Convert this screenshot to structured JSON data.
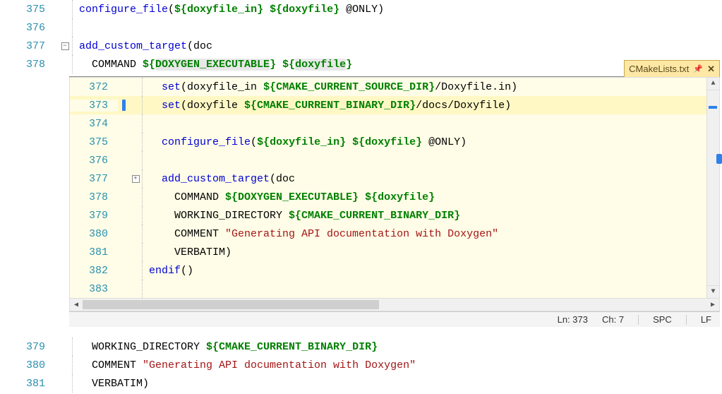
{
  "outer": {
    "lines": [
      {
        "num": "375",
        "html": "<span class='k-blue'>configure_file</span>(<span class='k-green'>${doxyfile_in}</span> <span class='k-green'>${doxyfile}</span> @ONLY)"
      },
      {
        "num": "376",
        "html": ""
      },
      {
        "num": "377",
        "html": "<span class='k-blue'>add_custom_target</span>(doc",
        "fold": true
      },
      {
        "num": "378",
        "html": "  COMMAND <span class='k-green'>${</span><span class='k-green hl'>DOXYGEN_EXECUTABLE</span><span class='k-green'>}</span> <span class='k-green'>${</span><span class='k-green hl'>doxyfile</span><span class='k-green'>}</span>"
      }
    ],
    "lines2": [
      {
        "num": "379",
        "html": "  WORKING_DIRECTORY <span class='k-green'>${CMAKE_CURRENT_BINARY_DIR}</span>"
      },
      {
        "num": "380",
        "html": "  COMMENT <span class='k-str'>\"Generating API documentation with Doxygen\"</span>"
      },
      {
        "num": "381",
        "html": "  VERBATIM)"
      }
    ]
  },
  "inner": {
    "tab": {
      "title": "CMakeLists.txt"
    },
    "lines": [
      {
        "num": "372",
        "html": "  <span class='k-blue'>set</span>(doxyfile_in <span class='k-green'>${CMAKE_CURRENT_SOURCE_DIR}</span>/Doxyfile.in)"
      },
      {
        "num": "373",
        "html": "  <span class='k-blue'>set</span>(doxyfile <span class='k-green'>${CMAKE_CURRENT_BINARY_DIR}</span>/docs/Doxyfile)",
        "current": true,
        "pip": true
      },
      {
        "num": "374",
        "html": ""
      },
      {
        "num": "375",
        "html": "  <span class='k-blue'>configure_file</span>(<span class='k-green'>${doxyfile_in}</span> <span class='k-green'>${doxyfile}</span> @ONLY)"
      },
      {
        "num": "376",
        "html": ""
      },
      {
        "num": "377",
        "html": "  <span class='k-blue'>add_custom_target</span>(doc",
        "fold": true
      },
      {
        "num": "378",
        "html": "    COMMAND <span class='k-green'>${DOXYGEN_EXECUTABLE}</span> <span class='k-green'>${doxyfile}</span>"
      },
      {
        "num": "379",
        "html": "    WORKING_DIRECTORY <span class='k-green'>${CMAKE_CURRENT_BINARY_DIR}</span>"
      },
      {
        "num": "380",
        "html": "    COMMENT <span class='k-str'>\"Generating API documentation with Doxygen\"</span>"
      },
      {
        "num": "381",
        "html": "    VERBATIM)"
      },
      {
        "num": "382",
        "html": "<span class='k-blue'>endif</span>()"
      },
      {
        "num": "383",
        "html": ""
      }
    ],
    "status": {
      "ln_label": "Ln:",
      "ln": "373",
      "ch_label": "Ch:",
      "ch": "7",
      "enc": "SPC",
      "eol": "LF"
    }
  }
}
